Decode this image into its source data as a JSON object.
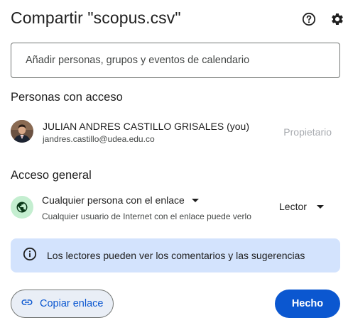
{
  "dialog": {
    "title": "Compartir \"scopus.csv\""
  },
  "add_people": {
    "placeholder": "Añadir personas, grupos y eventos de calendario"
  },
  "people_section": {
    "heading": "Personas con acceso",
    "users": [
      {
        "name": "JULIAN ANDRES CASTILLO GRISALES (you)",
        "email": "jandres.castillo@udea.edu.co",
        "role": "Propietario"
      }
    ]
  },
  "general_access": {
    "heading": "Acceso general",
    "access_level": "Cualquier persona con el enlace",
    "description": "Cualquier usuario de Internet con el enlace puede verlo",
    "role": "Lector"
  },
  "info_banner": {
    "text": "Los lectores pueden ver los comentarios y las sugerencias"
  },
  "footer": {
    "copy_link_label": "Copiar enlace",
    "done_label": "Hecho"
  },
  "colors": {
    "accent": "#0b57d0",
    "info_bg": "#d3e3fd",
    "globe_bg": "#c4eed0"
  },
  "icons": {
    "help": "help-circle-icon",
    "settings": "gear-icon",
    "globe": "globe-icon",
    "info": "info-icon",
    "link": "link-icon"
  }
}
